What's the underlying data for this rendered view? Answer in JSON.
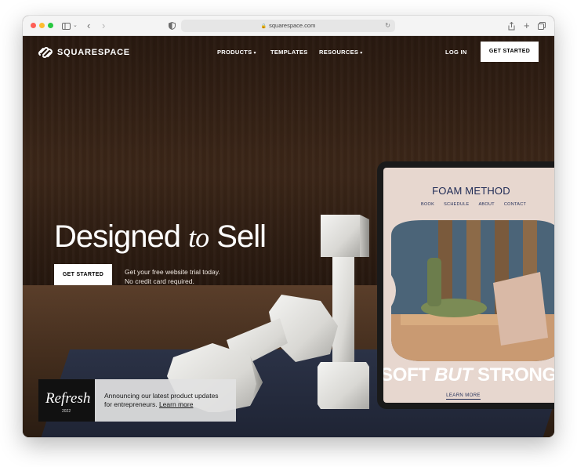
{
  "browser": {
    "url": "squarespace.com",
    "colors": {
      "close": "#fe5f57",
      "minimize": "#febc2e",
      "zoom": "#28c840"
    }
  },
  "nav": {
    "brand": "SQUARESPACE",
    "items": [
      "PRODUCTS",
      "TEMPLATES",
      "RESOURCES"
    ],
    "login": "LOG IN",
    "cta": "GET STARTED"
  },
  "hero": {
    "title_part1": "Designed",
    "title_italic": "to",
    "title_part2": "Sell",
    "cta": "GET STARTED",
    "subtitle_line1": "Get your free website trial today.",
    "subtitle_line2": "No credit card required."
  },
  "tablet": {
    "brand": "FOAM METHOD",
    "nav": [
      "BOOK",
      "SCHEDULE",
      "ABOUT",
      "CONTACT"
    ],
    "headline_part1": "SOFT",
    "headline_italic": "BUT",
    "headline_part2": "STRONG",
    "link": "LEARN MORE"
  },
  "announcement": {
    "thumb_title": "Refresh",
    "thumb_year": "2022",
    "text_line1": "Announcing our latest product updates",
    "text_line2": "for entrepreneurs.",
    "link": "Learn more"
  },
  "icons": [
    "sidebar-icon",
    "back-icon",
    "forward-icon",
    "shield-icon",
    "lock-icon",
    "reload-icon",
    "share-icon",
    "new-tab-icon",
    "tabs-icon",
    "chevron-down-icon"
  ]
}
